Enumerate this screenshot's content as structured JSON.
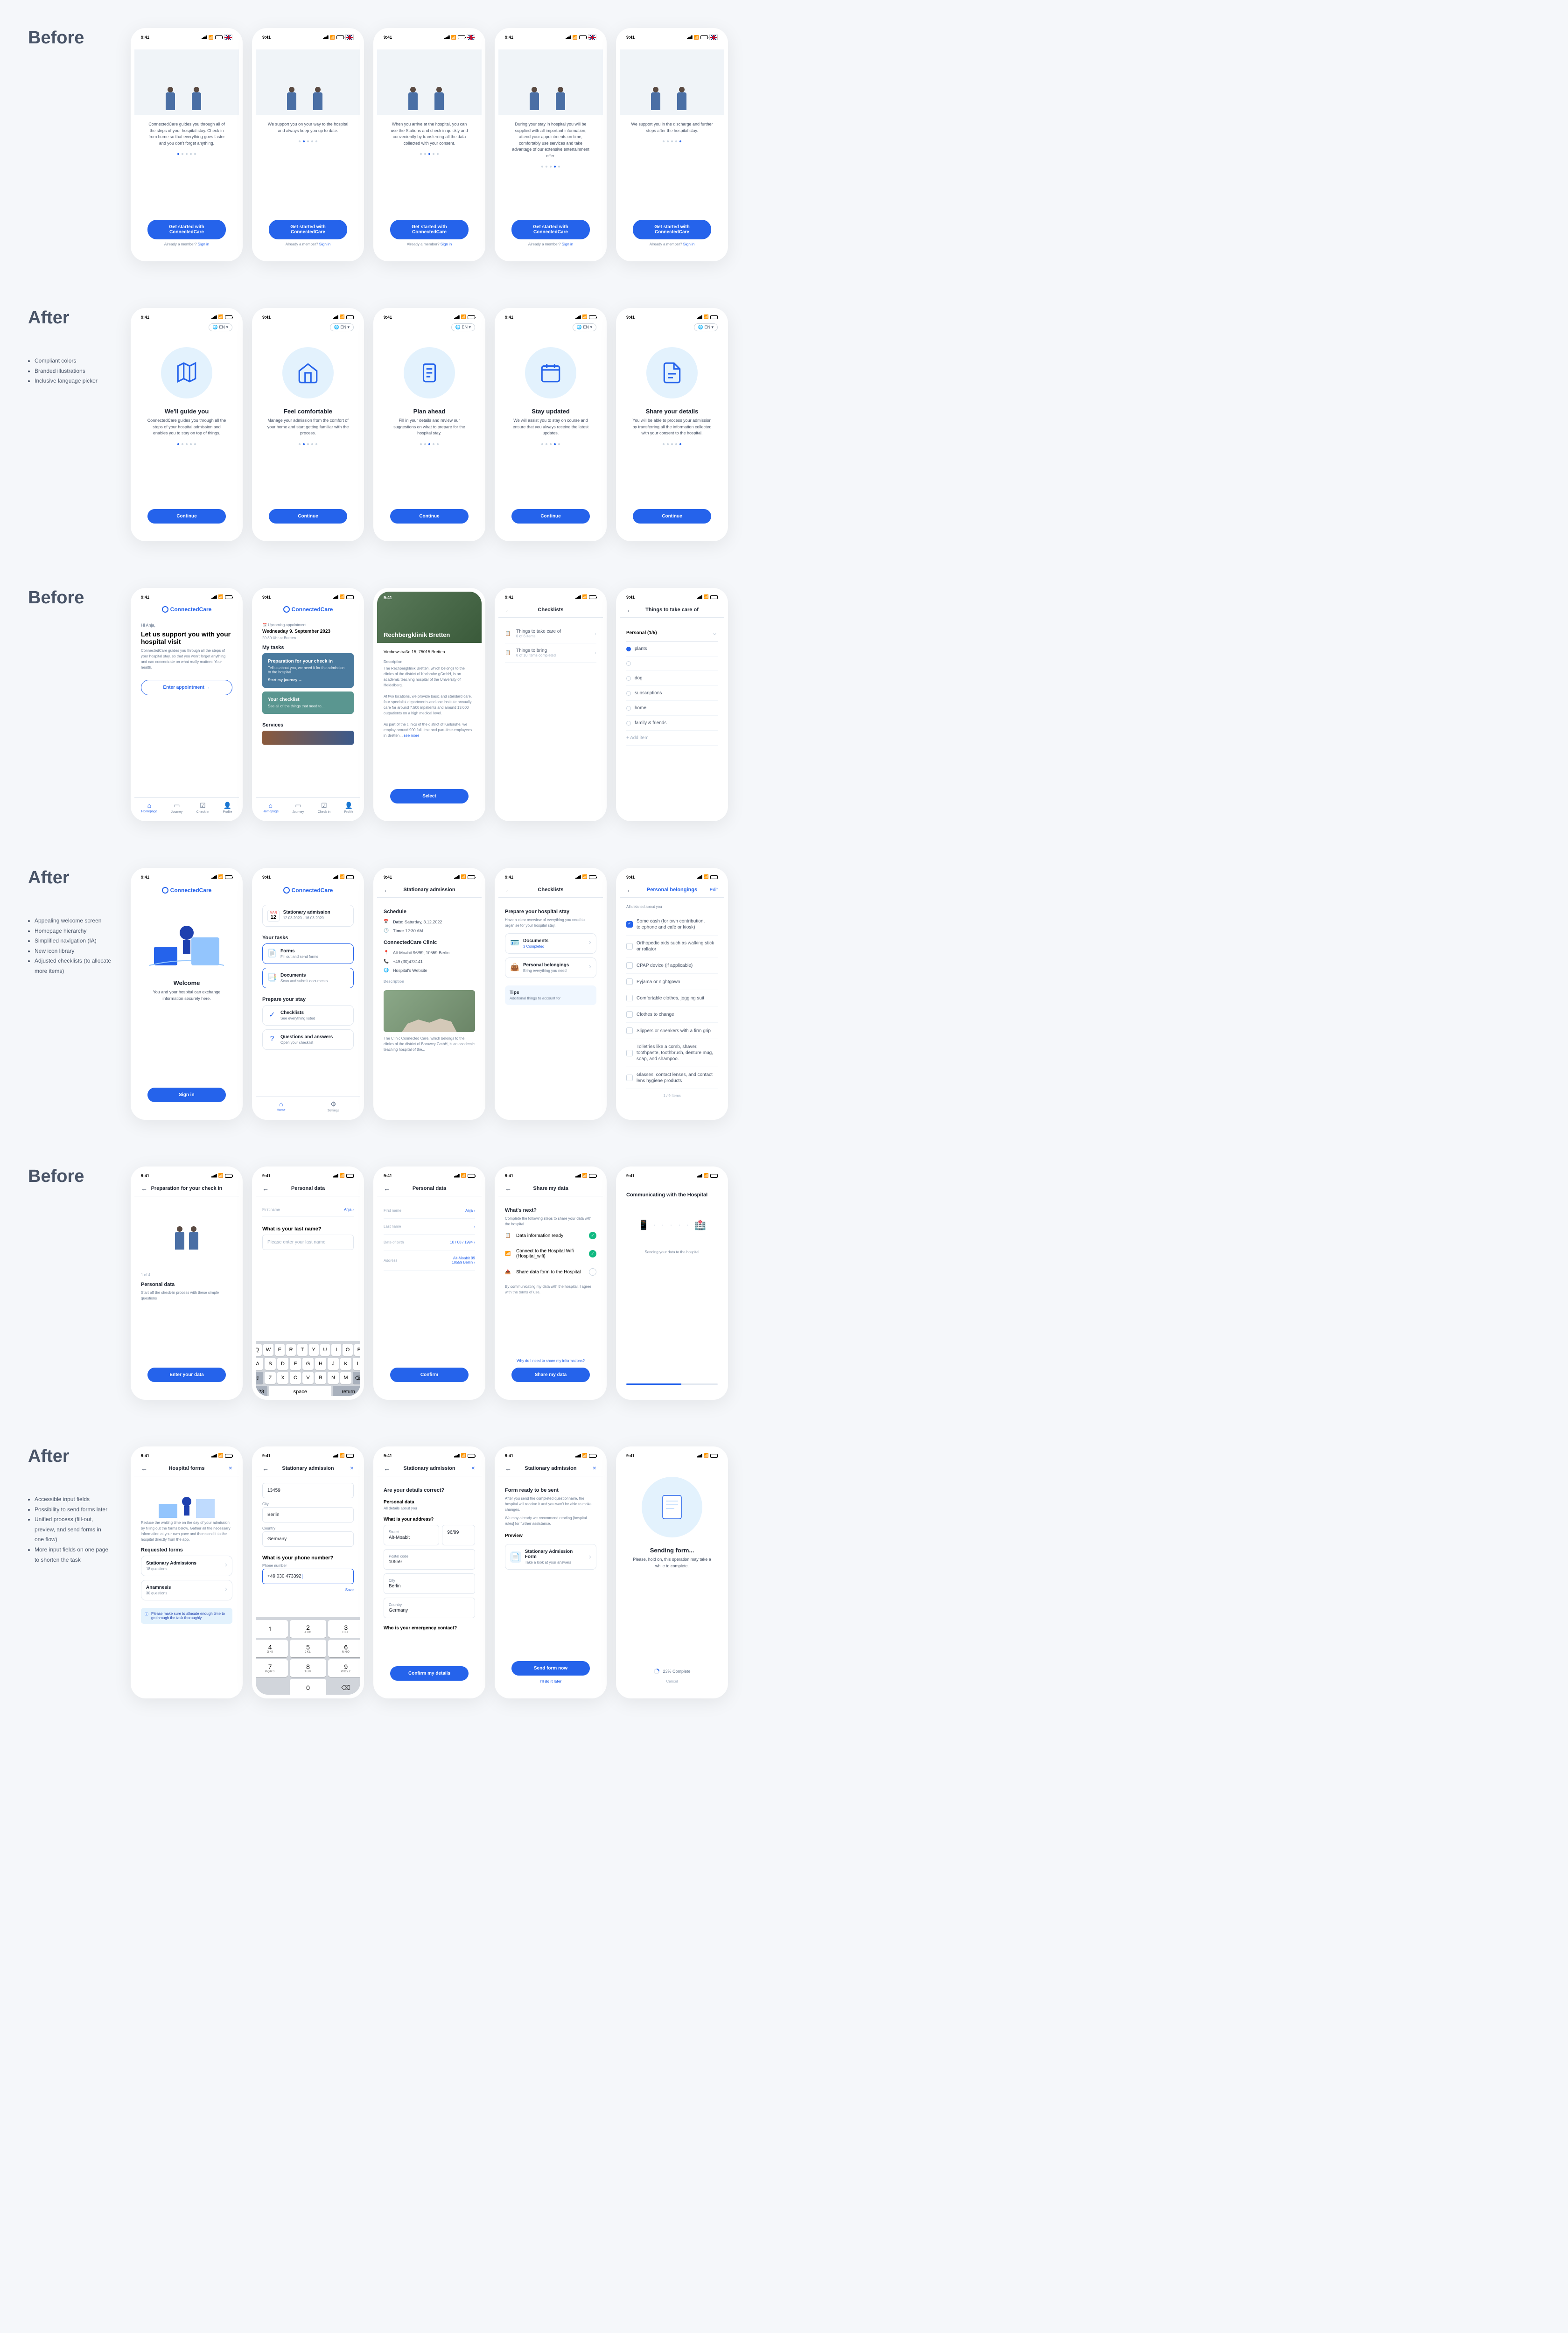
{
  "time": "9:41",
  "sections": {
    "s1": {
      "label": "Before",
      "onboard_before": [
        {
          "text": "ConnectedCare guides you through all of the steps of your hospital stay. Check in from home so that everything goes faster and you don't forget anything.",
          "dot": 0
        },
        {
          "text": "We support you on your way to the hospital and always keep you up to date.",
          "dot": 1
        },
        {
          "text": "When you arrive at the hospital, you can use the Stations and check in quickly and conveniently by transferring all the data collected with your consent.",
          "dot": 2
        },
        {
          "text": "During your stay in hospital you will be supplied with all important information, attend your appointments on time, comfortably use services and take advantage of our extensive entertainment offer.",
          "dot": 3
        },
        {
          "text": "We support you in the discharge and further steps after the hospital stay.",
          "dot": 4
        }
      ],
      "cta": "Get started with ConnectedCare",
      "signin": "Already a member?",
      "signin_link": "Sign in"
    },
    "s2": {
      "label": "After",
      "bullets": [
        "Compliant colors",
        "Branded illustrations",
        "Inclusive language picker"
      ],
      "lang": "EN",
      "onboard_after": [
        {
          "title": "We'll guide you",
          "text": "ConnectedCare guides you through all the steps of your hospital admission and enables you to stay on top of things.",
          "dot": 0,
          "icon": "map"
        },
        {
          "title": "Feel comfortable",
          "text": "Manage your admission from the comfort of your home and start getting familiar with the process.",
          "dot": 1,
          "icon": "house"
        },
        {
          "title": "Plan ahead",
          "text": "Fill in your details and review our suggestions on what to prepare for the hospital stay.",
          "dot": 2,
          "icon": "clipboard"
        },
        {
          "title": "Stay updated",
          "text": "We will assist you to stay on course and ensure that you always receive the latest updates.",
          "dot": 3,
          "icon": "calendar"
        },
        {
          "title": "Share your details",
          "text": "You will be able to process your admission by transferring all the information collected with your consent to the hospital.",
          "dot": 4,
          "icon": "document"
        }
      ],
      "continue": "Continue"
    },
    "s3": {
      "label": "Before",
      "brand": "ConnectedCare",
      "welcome_greeting": "Hi Anja,",
      "welcome_title": "Let us support you with your hospital visit",
      "welcome_text": "ConnectedCare guides you through all the steps of your hospital stay, so that you won't forget anything and can concentrate on what really matters: Your health.",
      "enter_btn": "Enter appointment",
      "tabs": [
        "Homepage",
        "Journey",
        "Check in",
        "Profile"
      ],
      "upcoming": "Upcoming appointment",
      "appt_date": "Wednesday 9. September 2023",
      "appt_time": "20:30 Uhr at Bretten",
      "my_tasks": "My tasks",
      "task1_title": "Preparation for your check in",
      "task1_sub": "Tell us about you, we need it for the admission to the hospital.",
      "task1_link": "Start my journey",
      "task2_title": "Your checklist",
      "task2_sub": "See all of the things that need to...",
      "services": "Services",
      "hospital_name": "Rechbergklinik Bretten",
      "hospital_addr": "Virchowstraße 15, 75015 Bretten",
      "desc_label": "Description",
      "hospital_desc": "The Rechbergklinik Bretten, which belongs to the clinics of the district of Karlsruhe gGmbH, is an academic teaching hospital of the University of Heidelberg.\n\nAt two locations, we provide basic and standard care, four specialist departments and one institute annually care for around 7,500 inpatients and around 13,000 outpatients on a high medical level.\n\nAs part of the clinics of the district of Karlsruhe, we employ around 900 full-time and part-time employees in Bretten...",
      "see_more": "see more",
      "select": "Select",
      "checklists": "Checklists",
      "checklist_items": [
        "Things to take care of",
        "Things to bring"
      ],
      "checklist_counts": [
        "0 of 6 items",
        "0 of 10 items completed"
      ],
      "personal_header": "Things to take care of",
      "personal_section": "Personal (1/5)",
      "personal_items": [
        "plants",
        "",
        "dog",
        "subscriptions",
        "home",
        "family & friends"
      ],
      "add_item": "+ Add item"
    },
    "s4": {
      "label": "After",
      "bullets": [
        "Appealing welcome screen",
        "Homepage hierarchy",
        "Simplified navigation (IA)",
        "New icon library",
        "Adjusted checklists (to allocate more items)"
      ],
      "brand": "ConnectedCare",
      "welcome_title": "Welcome",
      "welcome_text": "You and your hospital can exchange information securely here.",
      "sign_in": "Sign in",
      "tabs2": [
        "Home",
        "Settings"
      ],
      "stationary": "Stationary admission",
      "stationary_date": "12.03.2020 - 16.03.2020",
      "your_tasks": "Your tasks",
      "task_forms": "Forms",
      "task_forms_sub": "Fill out and send forms",
      "task_docs": "Documents",
      "task_docs_sub": "Scan and submit documents",
      "prepare": "Prepare your stay",
      "task_checklist": "Checklists",
      "task_checklist_sub": "See everything listed",
      "task_qa": "Questions and answers",
      "task_qa_sub": "Open your checklist",
      "schedule": "Schedule",
      "date_label": "Date:",
      "date_val": "Saturday, 3.12.2022",
      "time_label": "Time:",
      "time_val": "12:30 AM",
      "clinic_name": "ConnectedCare Clinic",
      "clinic_addr": "Alt-Moabit 96/99, 10559 Berlin",
      "clinic_phone": "+49 (30)473141",
      "clinic_web": "Hospital's Website",
      "clinic_desc": "The Clinic Connected Care, which belongs to the clinics of the district of Barowey GmbH, is an academic teaching hospital of the...",
      "checklists": "Checklists",
      "prepare_stay": "Prepare your hospital stay",
      "prepare_sub": "Have a clear overview of everything you need to organise for your hospital stay.",
      "cat_docs": "Documents",
      "cat_docs_sub": "3 Completed",
      "cat_belongings": "Personal belongings",
      "cat_belongings_sub": "Bring everything you need",
      "tips": "Tips",
      "tips_sub": "Additional things to account for",
      "belongings_title": "Personal belongings",
      "belongings_sub": "All detailed about you",
      "edit": "Edit",
      "belongings_items": [
        {
          "text": "Some cash (for own contribution, telephone and café or kiosk)",
          "checked": true
        },
        {
          "text": "Orthopedic aids such as walking stick or rollator",
          "checked": false
        },
        {
          "text": "CPAP device (if applicable)",
          "checked": false
        },
        {
          "text": "Pyjama or nightgown",
          "checked": false
        },
        {
          "text": "Comfortable clothes, jogging suit",
          "checked": false
        },
        {
          "text": "Clothes to change",
          "checked": false
        },
        {
          "text": "Slippers or sneakers with a firm grip",
          "checked": false
        },
        {
          "text": "Toiletries like a comb, shaver, toothpaste, toothbrush, denture mug, soap, and shampoo.",
          "checked": false
        },
        {
          "text": "Glasses, contact lenses, and contact lens hygiene products",
          "checked": false
        }
      ],
      "items_count": "1 / 9 Items"
    },
    "s5": {
      "label": "Before",
      "prep_title": "Preparation for your check in",
      "step": "1 of 4",
      "personal_data": "Personal data",
      "personal_sub": "Start off the check-in process with these simple questions",
      "enter_data": "Enter your data",
      "first_name": "First name",
      "first_name_val": "Anja",
      "last_name_q": "What is your last name?",
      "last_name_ph": "Please enter your last name",
      "last_name": "Last name",
      "dob": "Date of birth",
      "dob_val": "10 / 08 / 1994",
      "address": "Address",
      "address_val": "Alt-Moabit 99\n10559 Berlin",
      "confirm": "Confirm",
      "share_title": "Share my data",
      "whats_next": "What's next?",
      "whats_next_sub": "Complete the following steps to share your data with the hospital",
      "share1": "Data information ready",
      "share2": "Connect to the Hospital Wifi (Hospital_wifi)",
      "share3": "Share data form to the Hospital",
      "share_footer": "By communicating my data with the hospital, I agree with the terms of use.",
      "why": "Why do I need to share my informations?",
      "share_btn": "Share my data",
      "comm_title": "Communicating with the Hospital",
      "sending": "Sending your data to the hospital"
    },
    "s6": {
      "label": "After",
      "bullets": [
        "Accessible input fields",
        "Possibility to send forms later",
        "Unified process (fill-out, preview, and send forms in one flow)",
        "More input fields on one page to shorten the task"
      ],
      "forms_title": "Hospital forms",
      "reduce_text": "Reduce the waiting time on the day of your admission by filling out the forms below. Gather all the necessary information at your own pace and then send it to the hospital directly from the app.",
      "requested": "Requested forms",
      "form1": "Stationary Admissions",
      "form1_sub": "18 questions",
      "form2": "Anamnesis",
      "form2_sub": "30 questions",
      "banner": "Please make sure to allocate enough time to go through the task thoroughly.",
      "stationary": "Stationary admission",
      "step_postal": "13459",
      "city_label": "City",
      "city_val": "Berlin",
      "country_label": "Country",
      "country_val": "Germany",
      "phone_q": "What is your phone number?",
      "phone_label": "Phone number",
      "phone_val": "+49 030 473392",
      "save": "Save",
      "correct_q": "Are your details correct?",
      "personal_data": "Personal data",
      "personal_sub": "All details about you",
      "addr_q": "What is your address?",
      "street": "Street",
      "street_val": "Alt-Moabit",
      "street_no": "96/99",
      "postal": "Postal code",
      "postal_val": "10559",
      "emergency_q": "Who is your emergency contact?",
      "confirm_details": "Confirm my details",
      "ready_title": "Form ready to be sent",
      "ready_text": "After you send the completed questionnaire, the hospital will receive it and you won't be able to make changes.",
      "ready_text2": "We may already we recommend reading [hospital rules] for further assistance.",
      "preview": "Preview",
      "preview_form": "Stationary Admission Form",
      "preview_sub": "Take a look at your answers",
      "send_now": "Send form now",
      "send_later": "I'll do it later",
      "sending": "Sending form...",
      "sending_sub": "Please, hold on, this operation may take a while to complete.",
      "progress": "23% Complete",
      "cancel": "Cancel"
    }
  }
}
